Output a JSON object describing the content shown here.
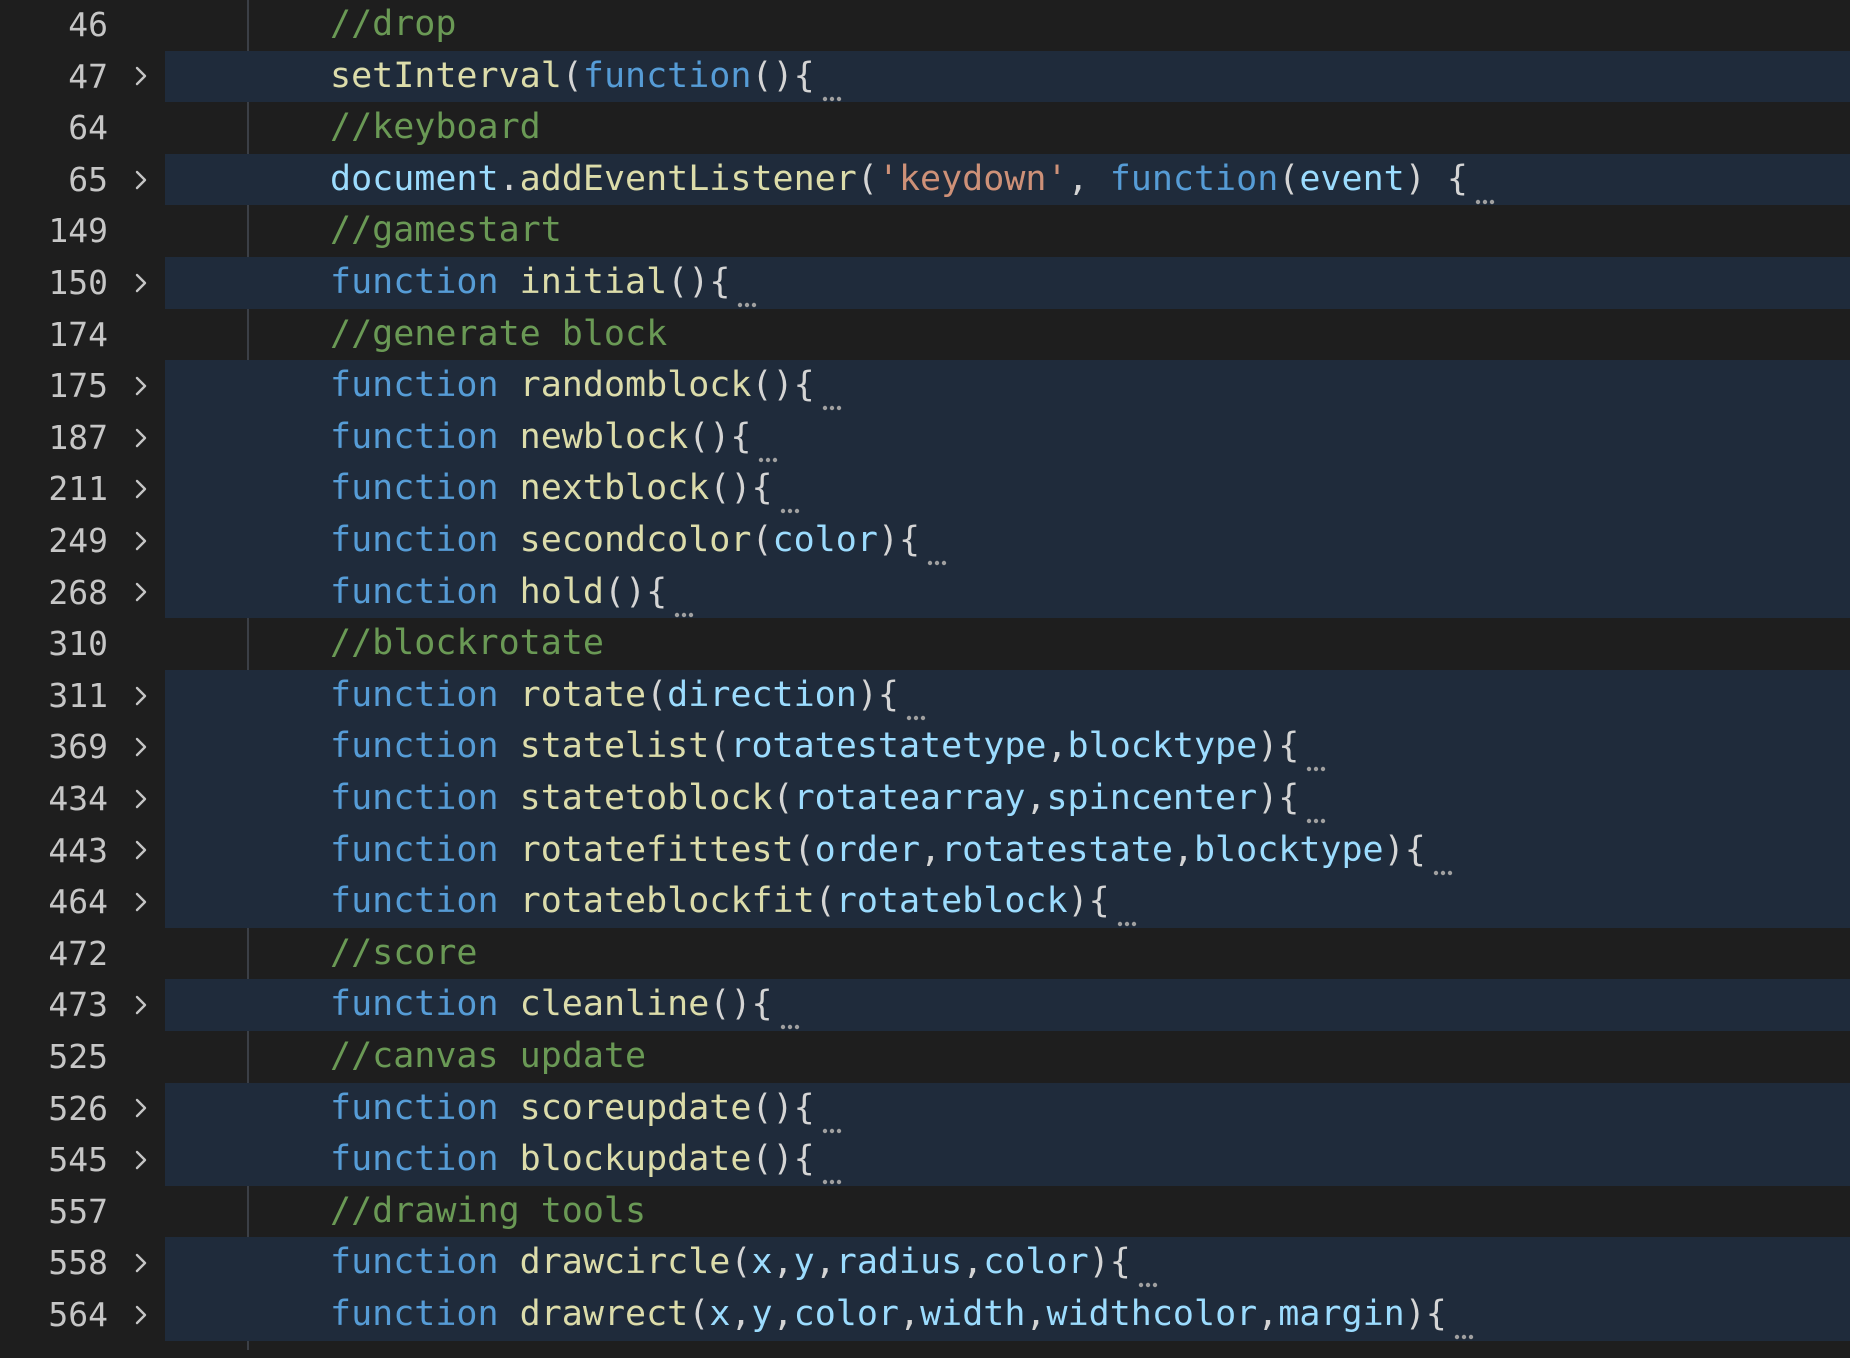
{
  "editor": {
    "colors": {
      "background": "#1e1e1e",
      "folded_highlight": "#1f2b3b",
      "line_number": "#c6c6c6",
      "comment": "#6a9955",
      "keyword": "#569cd6",
      "function_name": "#dcdcaa",
      "variable": "#9cdcfe",
      "string": "#ce9178",
      "punctuation": "#d4d4d4"
    },
    "lines": [
      {
        "num": "46",
        "folded": false,
        "tokens": [
          {
            "t": "//drop",
            "c": "comment"
          }
        ]
      },
      {
        "num": "47",
        "folded": true,
        "tokens": [
          {
            "t": "setInterval",
            "c": "fn"
          },
          {
            "t": "(",
            "c": "punc"
          },
          {
            "t": "function",
            "c": "kw"
          },
          {
            "t": "(){",
            "c": "punc"
          }
        ]
      },
      {
        "num": "64",
        "folded": false,
        "tokens": [
          {
            "t": "//keyboard",
            "c": "comment"
          }
        ]
      },
      {
        "num": "65",
        "folded": true,
        "tokens": [
          {
            "t": "document",
            "c": "var"
          },
          {
            "t": ".",
            "c": "punc"
          },
          {
            "t": "addEventListener",
            "c": "fn"
          },
          {
            "t": "(",
            "c": "punc"
          },
          {
            "t": "'keydown'",
            "c": "str"
          },
          {
            "t": ", ",
            "c": "punc"
          },
          {
            "t": "function",
            "c": "kw"
          },
          {
            "t": "(",
            "c": "punc"
          },
          {
            "t": "event",
            "c": "var"
          },
          {
            "t": ") {",
            "c": "punc"
          }
        ]
      },
      {
        "num": "149",
        "folded": false,
        "tokens": [
          {
            "t": "//gamestart",
            "c": "comment"
          }
        ]
      },
      {
        "num": "150",
        "folded": true,
        "tokens": [
          {
            "t": "function",
            "c": "kw"
          },
          {
            "t": " ",
            "c": "punc"
          },
          {
            "t": "initial",
            "c": "fn"
          },
          {
            "t": "(){",
            "c": "punc"
          }
        ]
      },
      {
        "num": "174",
        "folded": false,
        "tokens": [
          {
            "t": "//generate block",
            "c": "comment"
          }
        ]
      },
      {
        "num": "175",
        "folded": true,
        "tokens": [
          {
            "t": "function",
            "c": "kw"
          },
          {
            "t": " ",
            "c": "punc"
          },
          {
            "t": "randomblock",
            "c": "fn"
          },
          {
            "t": "(){",
            "c": "punc"
          }
        ]
      },
      {
        "num": "187",
        "folded": true,
        "tokens": [
          {
            "t": "function",
            "c": "kw"
          },
          {
            "t": " ",
            "c": "punc"
          },
          {
            "t": "newblock",
            "c": "fn"
          },
          {
            "t": "(){",
            "c": "punc"
          }
        ]
      },
      {
        "num": "211",
        "folded": true,
        "tokens": [
          {
            "t": "function",
            "c": "kw"
          },
          {
            "t": " ",
            "c": "punc"
          },
          {
            "t": "nextblock",
            "c": "fn"
          },
          {
            "t": "(){",
            "c": "punc"
          }
        ]
      },
      {
        "num": "249",
        "folded": true,
        "tokens": [
          {
            "t": "function",
            "c": "kw"
          },
          {
            "t": " ",
            "c": "punc"
          },
          {
            "t": "secondcolor",
            "c": "fn"
          },
          {
            "t": "(",
            "c": "punc"
          },
          {
            "t": "color",
            "c": "var"
          },
          {
            "t": "){",
            "c": "punc"
          }
        ]
      },
      {
        "num": "268",
        "folded": true,
        "tokens": [
          {
            "t": "function",
            "c": "kw"
          },
          {
            "t": " ",
            "c": "punc"
          },
          {
            "t": "hold",
            "c": "fn"
          },
          {
            "t": "(){",
            "c": "punc"
          }
        ]
      },
      {
        "num": "310",
        "folded": false,
        "tokens": [
          {
            "t": "//blockrotate",
            "c": "comment"
          }
        ]
      },
      {
        "num": "311",
        "folded": true,
        "tokens": [
          {
            "t": "function",
            "c": "kw"
          },
          {
            "t": " ",
            "c": "punc"
          },
          {
            "t": "rotate",
            "c": "fn"
          },
          {
            "t": "(",
            "c": "punc"
          },
          {
            "t": "direction",
            "c": "var"
          },
          {
            "t": "){",
            "c": "punc"
          }
        ]
      },
      {
        "num": "369",
        "folded": true,
        "tokens": [
          {
            "t": "function",
            "c": "kw"
          },
          {
            "t": " ",
            "c": "punc"
          },
          {
            "t": "statelist",
            "c": "fn"
          },
          {
            "t": "(",
            "c": "punc"
          },
          {
            "t": "rotatestatetype",
            "c": "var"
          },
          {
            "t": ",",
            "c": "punc"
          },
          {
            "t": "blocktype",
            "c": "var"
          },
          {
            "t": "){",
            "c": "punc"
          }
        ]
      },
      {
        "num": "434",
        "folded": true,
        "tokens": [
          {
            "t": "function",
            "c": "kw"
          },
          {
            "t": " ",
            "c": "punc"
          },
          {
            "t": "statetoblock",
            "c": "fn"
          },
          {
            "t": "(",
            "c": "punc"
          },
          {
            "t": "rotatearray",
            "c": "var"
          },
          {
            "t": ",",
            "c": "punc"
          },
          {
            "t": "spincenter",
            "c": "var"
          },
          {
            "t": "){",
            "c": "punc"
          }
        ]
      },
      {
        "num": "443",
        "folded": true,
        "tokens": [
          {
            "t": "function",
            "c": "kw"
          },
          {
            "t": " ",
            "c": "punc"
          },
          {
            "t": "rotatefittest",
            "c": "fn"
          },
          {
            "t": "(",
            "c": "punc"
          },
          {
            "t": "order",
            "c": "var"
          },
          {
            "t": ",",
            "c": "punc"
          },
          {
            "t": "rotatestate",
            "c": "var"
          },
          {
            "t": ",",
            "c": "punc"
          },
          {
            "t": "blocktype",
            "c": "var"
          },
          {
            "t": "){",
            "c": "punc"
          }
        ]
      },
      {
        "num": "464",
        "folded": true,
        "tokens": [
          {
            "t": "function",
            "c": "kw"
          },
          {
            "t": " ",
            "c": "punc"
          },
          {
            "t": "rotateblockfit",
            "c": "fn"
          },
          {
            "t": "(",
            "c": "punc"
          },
          {
            "t": "rotateblock",
            "c": "var"
          },
          {
            "t": "){",
            "c": "punc"
          }
        ]
      },
      {
        "num": "472",
        "folded": false,
        "tokens": [
          {
            "t": "//score",
            "c": "comment"
          }
        ]
      },
      {
        "num": "473",
        "folded": true,
        "tokens": [
          {
            "t": "function",
            "c": "kw"
          },
          {
            "t": " ",
            "c": "punc"
          },
          {
            "t": "cleanline",
            "c": "fn"
          },
          {
            "t": "(){",
            "c": "punc"
          }
        ]
      },
      {
        "num": "525",
        "folded": false,
        "tokens": [
          {
            "t": "//canvas update",
            "c": "comment"
          }
        ]
      },
      {
        "num": "526",
        "folded": true,
        "tokens": [
          {
            "t": "function",
            "c": "kw"
          },
          {
            "t": " ",
            "c": "punc"
          },
          {
            "t": "scoreupdate",
            "c": "fn"
          },
          {
            "t": "(){",
            "c": "punc"
          }
        ]
      },
      {
        "num": "545",
        "folded": true,
        "tokens": [
          {
            "t": "function",
            "c": "kw"
          },
          {
            "t": " ",
            "c": "punc"
          },
          {
            "t": "blockupdate",
            "c": "fn"
          },
          {
            "t": "(){",
            "c": "punc"
          }
        ]
      },
      {
        "num": "557",
        "folded": false,
        "tokens": [
          {
            "t": "//drawing tools",
            "c": "comment"
          }
        ]
      },
      {
        "num": "558",
        "folded": true,
        "tokens": [
          {
            "t": "function",
            "c": "kw"
          },
          {
            "t": " ",
            "c": "punc"
          },
          {
            "t": "drawcircle",
            "c": "fn"
          },
          {
            "t": "(",
            "c": "punc"
          },
          {
            "t": "x",
            "c": "var"
          },
          {
            "t": ",",
            "c": "punc"
          },
          {
            "t": "y",
            "c": "var"
          },
          {
            "t": ",",
            "c": "punc"
          },
          {
            "t": "radius",
            "c": "var"
          },
          {
            "t": ",",
            "c": "punc"
          },
          {
            "t": "color",
            "c": "var"
          },
          {
            "t": "){",
            "c": "punc"
          }
        ]
      },
      {
        "num": "564",
        "folded": true,
        "tokens": [
          {
            "t": "function",
            "c": "kw"
          },
          {
            "t": " ",
            "c": "punc"
          },
          {
            "t": "drawrect",
            "c": "fn"
          },
          {
            "t": "(",
            "c": "punc"
          },
          {
            "t": "x",
            "c": "var"
          },
          {
            "t": ",",
            "c": "punc"
          },
          {
            "t": "y",
            "c": "var"
          },
          {
            "t": ",",
            "c": "punc"
          },
          {
            "t": "color",
            "c": "var"
          },
          {
            "t": ",",
            "c": "punc"
          },
          {
            "t": "width",
            "c": "var"
          },
          {
            "t": ",",
            "c": "punc"
          },
          {
            "t": "widthcolor",
            "c": "var"
          },
          {
            "t": ",",
            "c": "punc"
          },
          {
            "t": "margin",
            "c": "var"
          },
          {
            "t": "){",
            "c": "punc"
          }
        ]
      }
    ]
  }
}
